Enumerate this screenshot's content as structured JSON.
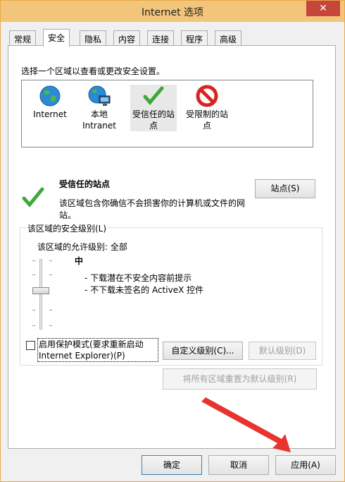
{
  "window": {
    "title": "Internet 选项",
    "close_icon": "✕"
  },
  "tabs": [
    "常规",
    "安全",
    "隐私",
    "内容",
    "连接",
    "程序",
    "高级"
  ],
  "active_tab": "安全",
  "security": {
    "instruction": "选择一个区域以查看或更改安全设置。",
    "zones": [
      {
        "label": "Internet",
        "icon": "globe-icon"
      },
      {
        "label": "本地\nIntranet",
        "icon": "intranet-icon"
      },
      {
        "label": "受信任的站\n点",
        "icon": "checkmark-icon"
      },
      {
        "label": "受限制的站\n点",
        "icon": "prohibited-icon"
      }
    ],
    "selected_zone": "受信任的站点",
    "zone_title": "受信任的站点",
    "zone_desc": "该区域包含你确信不会损害你的计算机或文件的网站。",
    "sites_button": "站点(S)",
    "level_group_label": "该区域的安全级别(L)",
    "allowed_levels": "该区域的允许级别: 全部",
    "level_name": "中",
    "level_bullets": [
      "- 下载潜在不安全内容前提示",
      "- 不下载未签名的 ActiveX 控件"
    ],
    "protected_mode_label": "启用保护模式(要求重新启动 Internet Explorer)(P)",
    "protected_mode_checked": false,
    "custom_level_button": "自定义级别(C)...",
    "default_level_button": "默认级别(D)",
    "reset_all_button": "将所有区域重置为默认级别(R)"
  },
  "footer": {
    "ok": "确定",
    "cancel": "取消",
    "apply": "应用(A)"
  },
  "colors": {
    "title_bar": "#f2c57a",
    "close_button": "#c7463b",
    "annotation_arrow": "#e8342e"
  }
}
